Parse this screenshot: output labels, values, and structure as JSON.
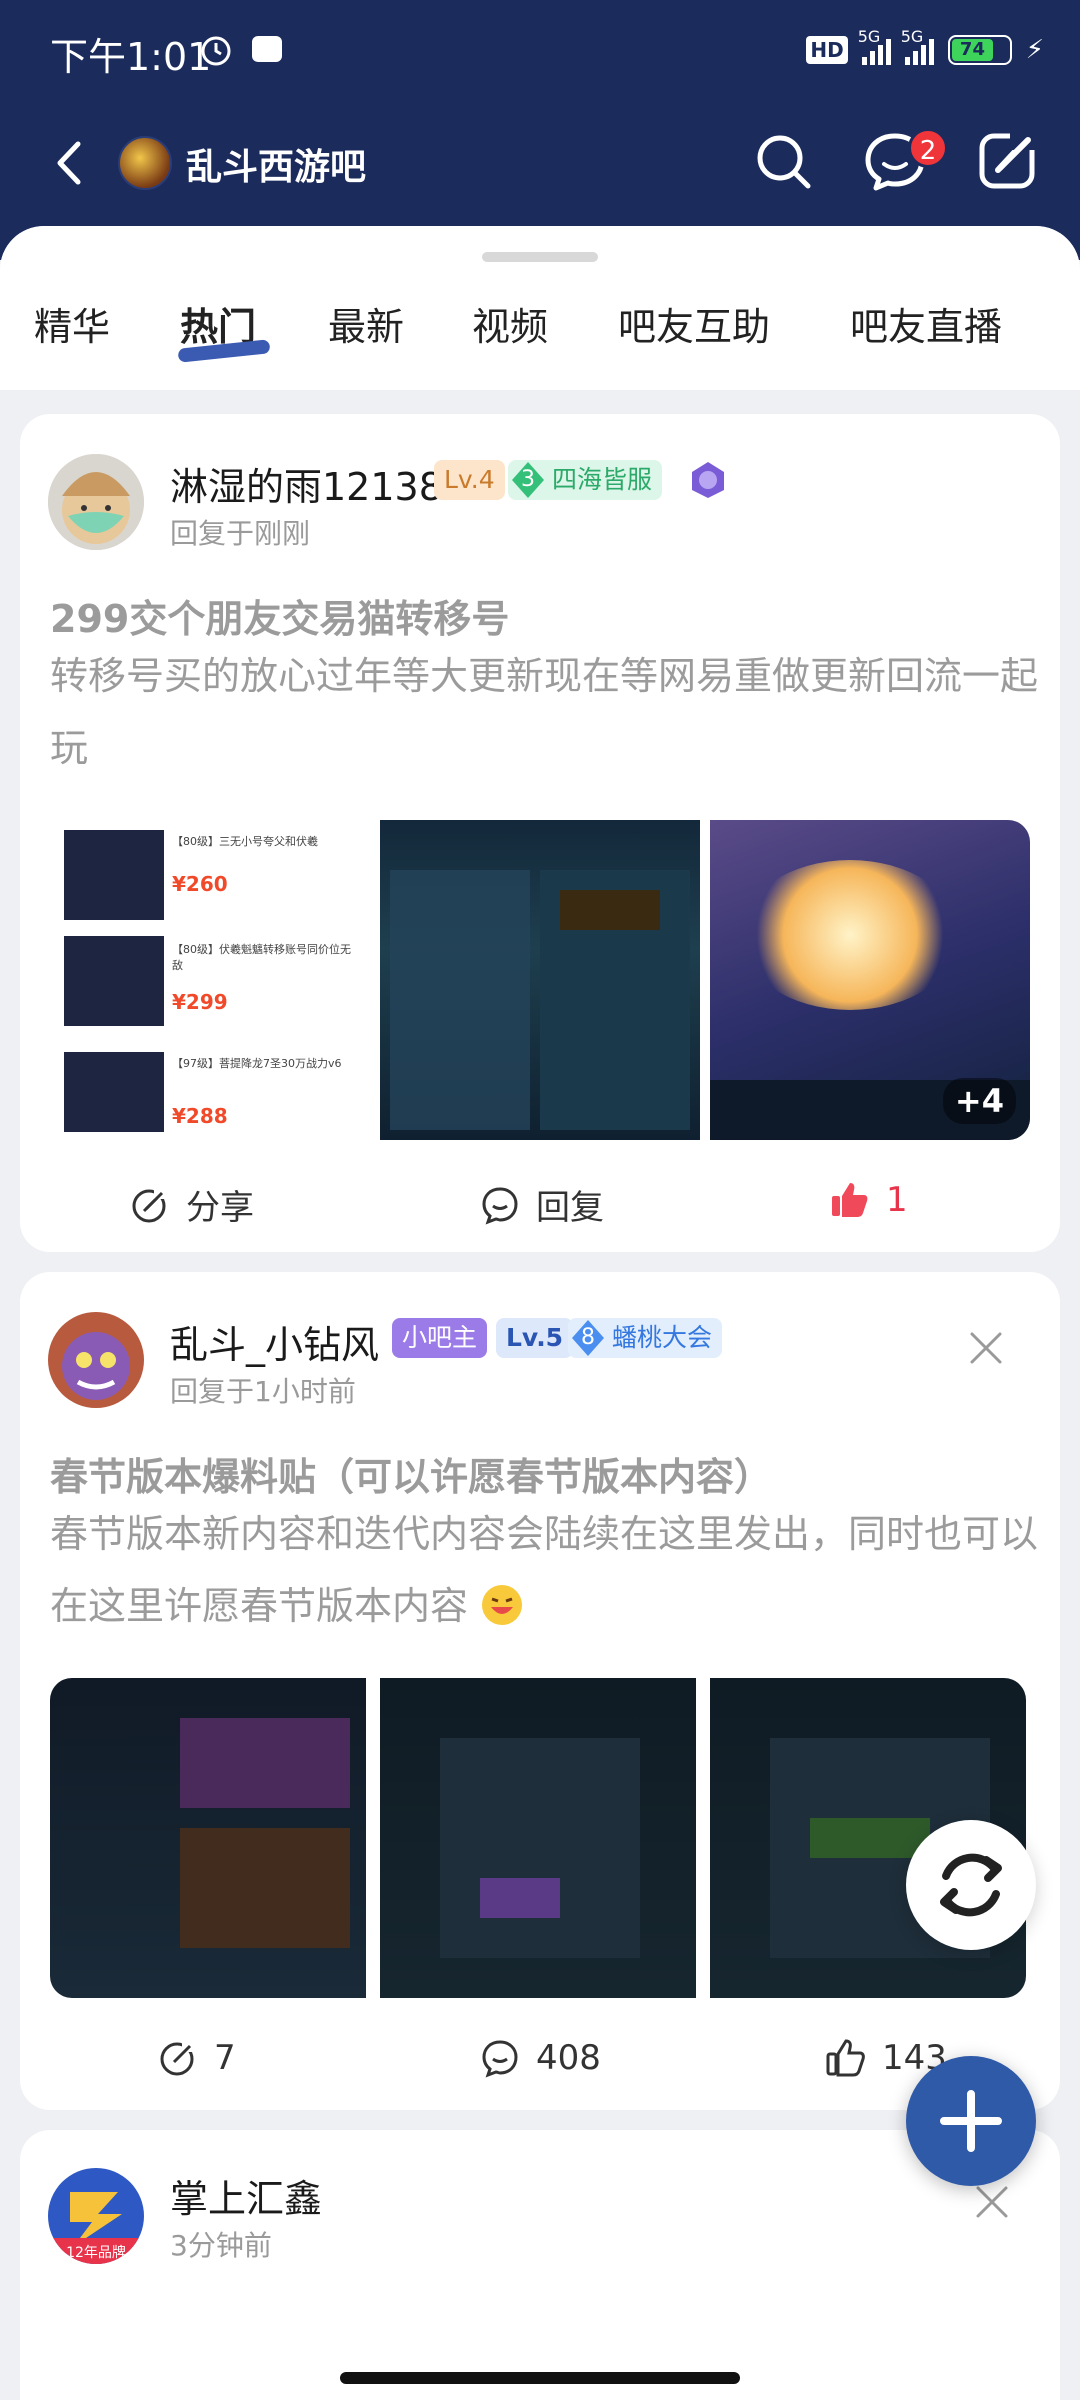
{
  "status_bar": {
    "time": "下午1:01",
    "hd": "HD",
    "sig1": "5G",
    "sig2": "5G",
    "battery": "74"
  },
  "nav": {
    "title": "乱斗西游吧",
    "msg_badge": "2"
  },
  "tabs": [
    {
      "label": "精华"
    },
    {
      "label": "热门"
    },
    {
      "label": "最新"
    },
    {
      "label": "视频"
    },
    {
      "label": "吧友互助"
    },
    {
      "label": "吧友直播"
    }
  ],
  "posts": [
    {
      "user": "淋湿的雨12138",
      "level": "Lv.4",
      "badge_num": "3",
      "badge_text": "四海皆服",
      "time": "回复于刚刚",
      "title": "299交个朋友交易猫转移号",
      "body": "转移号买的放心过年等大更新现在等网易重做更新回流一起玩",
      "more_images": "+4",
      "share": "分享",
      "reply": "回复",
      "likes": "1",
      "thumb1_lines": [
        {
          "t": "【80级】三无小号夸父和伏羲",
          "p": "¥260"
        },
        {
          "t": "【80级】伏羲魁魑转移账号同价位无敌",
          "p": "¥299"
        },
        {
          "t": "【97级】菩提降龙7圣30万战力v6",
          "p": "¥288"
        }
      ]
    },
    {
      "user": "乱斗_小钻风",
      "role": "小吧主",
      "level": "Lv.5",
      "badge_num": "8",
      "badge_text": "蟠桃大会",
      "time": "回复于1小时前",
      "title": "春节版本爆料贴（可以许愿春节版本内容）",
      "body": "春节版本新内容和迭代内容会陆续在这里发出，同时也可以在这里许愿春节版本内容",
      "shares": "7",
      "replies": "408",
      "likes": "143"
    },
    {
      "user": "掌上汇鑫",
      "time": "3分钟前",
      "avatar_tag": "12年品牌"
    }
  ]
}
